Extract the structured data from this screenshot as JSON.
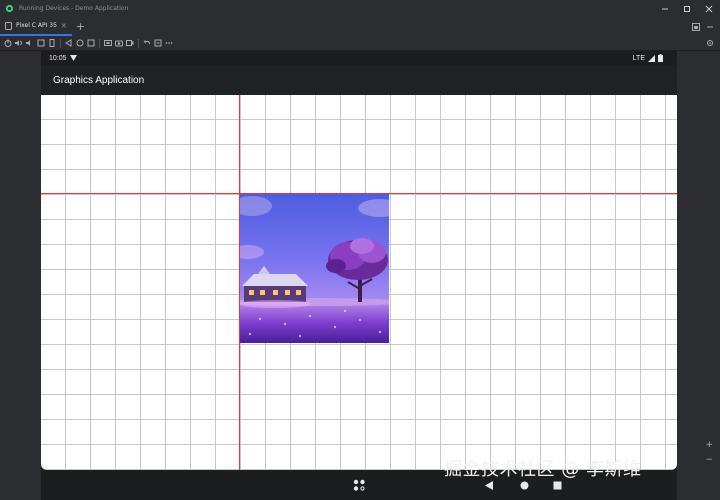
{
  "window": {
    "title": "Running Devices - Demo Application",
    "controls": [
      "minimize-icon",
      "maximize-icon",
      "close-icon"
    ]
  },
  "tabs": [
    {
      "label": "Pixel C API 35",
      "active": true
    }
  ],
  "toolbar": {
    "icons": [
      "power-icon",
      "volume-up-icon",
      "volume-down-icon",
      "rotate-left-icon",
      "rotate-right-icon",
      "back-icon",
      "home-icon",
      "overview-icon",
      "screenshot-icon",
      "camera-icon",
      "screen-record-icon",
      "undo-icon",
      "redo-icon",
      "more-icon"
    ]
  },
  "device": {
    "status_bar": {
      "time": "10:05",
      "network": "LTE"
    },
    "app_bar": {
      "title": "Graphics Application"
    }
  },
  "colors": {
    "ide_background": "#2b2d30",
    "accent": "#3574f0",
    "axis_line": "#e53935",
    "grid_line": "#c8c8c8",
    "app_bar": "#202124"
  },
  "watermark": "掘金技术社区 @ 李斯维"
}
